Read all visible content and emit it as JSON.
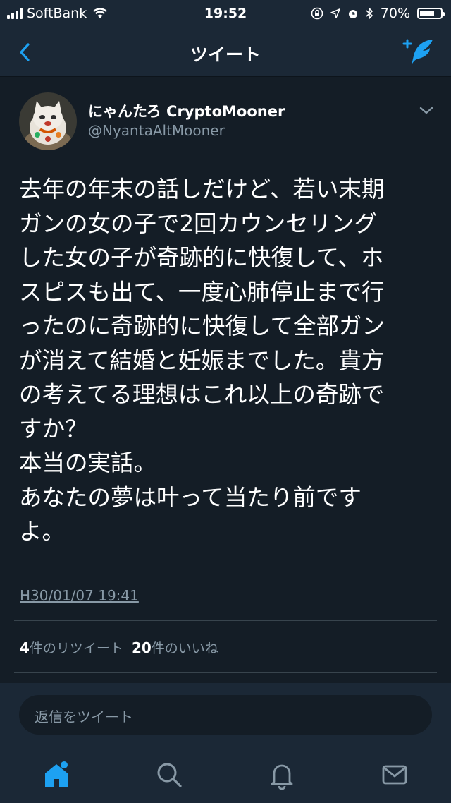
{
  "status_bar": {
    "carrier": "SoftBank",
    "time": "19:52",
    "battery": "70%",
    "battery_level": 0.7
  },
  "nav": {
    "title": "ツイート",
    "back_icon": "chevron-left-icon",
    "compose_icon": "compose-tweet-icon"
  },
  "tweet": {
    "display_name": "にゃんたろ CryptoMooner",
    "handle": "@NyantaAltMooner",
    "text": "去年の年末の話しだけど、若い末期\nガンの女の子で2回カウンセリング\nした女の子が奇跡的に快復して、ホ\nスピスも出て、一度心肺停止まで行\nったのに奇跡的に快復して全部ガン\nが消えて結婚と妊娠までした。貴方\nの考えてる理想はこれ以上の奇跡で\nすか？\n本当の実話。\nあなたの夢は叶って当たり前です\nよ。",
    "timestamp": "H30/01/07 19:41",
    "retweet_count": "4",
    "retweet_label": "件のリツイート",
    "like_count": "20",
    "like_label": "件のいいね"
  },
  "reply": {
    "placeholder": "返信をツイート"
  },
  "tabs": [
    "home-icon",
    "search-icon",
    "notifications-icon",
    "messages-icon"
  ],
  "colors": {
    "background": "#141d26",
    "bar": "#1b2836",
    "accent": "#1da1f2",
    "muted": "#8899a6"
  }
}
